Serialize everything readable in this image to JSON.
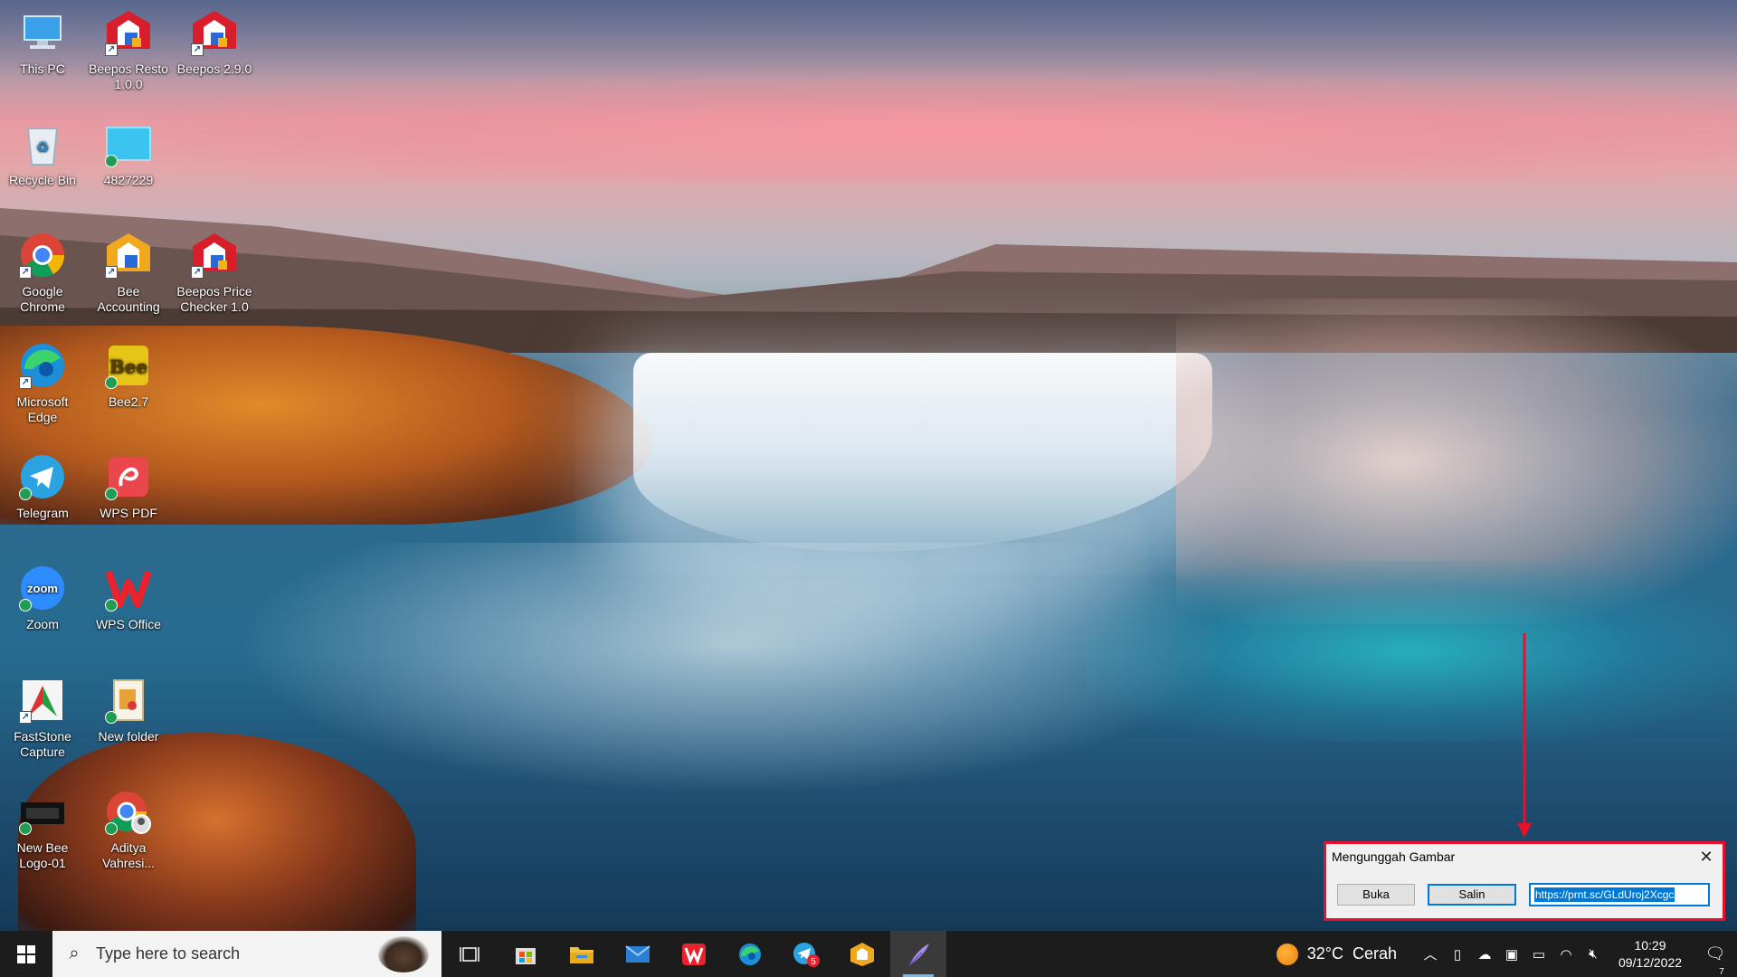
{
  "desktop": {
    "icons": [
      {
        "label": "This PC",
        "icon": "computer-icon"
      },
      {
        "label": "Beepos Resto 1.0.0",
        "icon": "beepos-icon"
      },
      {
        "label": "Beepos 2.9.0",
        "icon": "beepos-icon"
      },
      {
        "label": "Recycle Bin",
        "icon": "recycle-bin-icon"
      },
      {
        "label": "4827229",
        "icon": "image-file-icon"
      },
      {
        "label": "Google Chrome",
        "icon": "chrome-icon"
      },
      {
        "label": "Bee Accounting",
        "icon": "bee-accounting-icon"
      },
      {
        "label": "Beepos Price Checker 1.0",
        "icon": "beepos-icon"
      },
      {
        "label": "Microsoft Edge",
        "icon": "edge-icon"
      },
      {
        "label": "Bee2.7",
        "icon": "bee-icon"
      },
      {
        "label": "Telegram",
        "icon": "telegram-icon"
      },
      {
        "label": "WPS PDF",
        "icon": "wps-pdf-icon"
      },
      {
        "label": "Zoom",
        "icon": "zoom-icon"
      },
      {
        "label": "WPS Office",
        "icon": "wps-office-icon"
      },
      {
        "label": "FastStone Capture",
        "icon": "faststone-icon"
      },
      {
        "label": "New folder",
        "icon": "folder-icon"
      },
      {
        "label": "New Bee Logo-01",
        "icon": "image-file-icon"
      },
      {
        "label": "Aditya Vahresi...",
        "icon": "chrome-profile-icon"
      }
    ],
    "zoom_glyph": "zoom",
    "bee_glyph": "Bee"
  },
  "dialog": {
    "title": "Mengunggah Gambar",
    "close_glyph": "✕",
    "open_label": "Buka",
    "copy_label": "Salin",
    "url": "https://prnt.sc/GLdUroj2Xcgc"
  },
  "taskbar": {
    "search_placeholder": "Type here to search",
    "apps": [
      "task-view-icon",
      "store-icon",
      "file-explorer-icon",
      "mail-icon",
      "wps-office-icon",
      "edge-icon",
      "telegram-icon",
      "bee-accounting-icon",
      "feather-icon"
    ],
    "telegram_badge": "5",
    "weather": {
      "temp": "32°C",
      "condition": "Cerah"
    },
    "clock": {
      "time": "10:29",
      "date": "09/12/2022"
    },
    "notification_count": "7"
  },
  "colors": {
    "highlight_frame": "#e8112d",
    "selection": "#0078d7",
    "taskbar": "#1c1c1c"
  }
}
